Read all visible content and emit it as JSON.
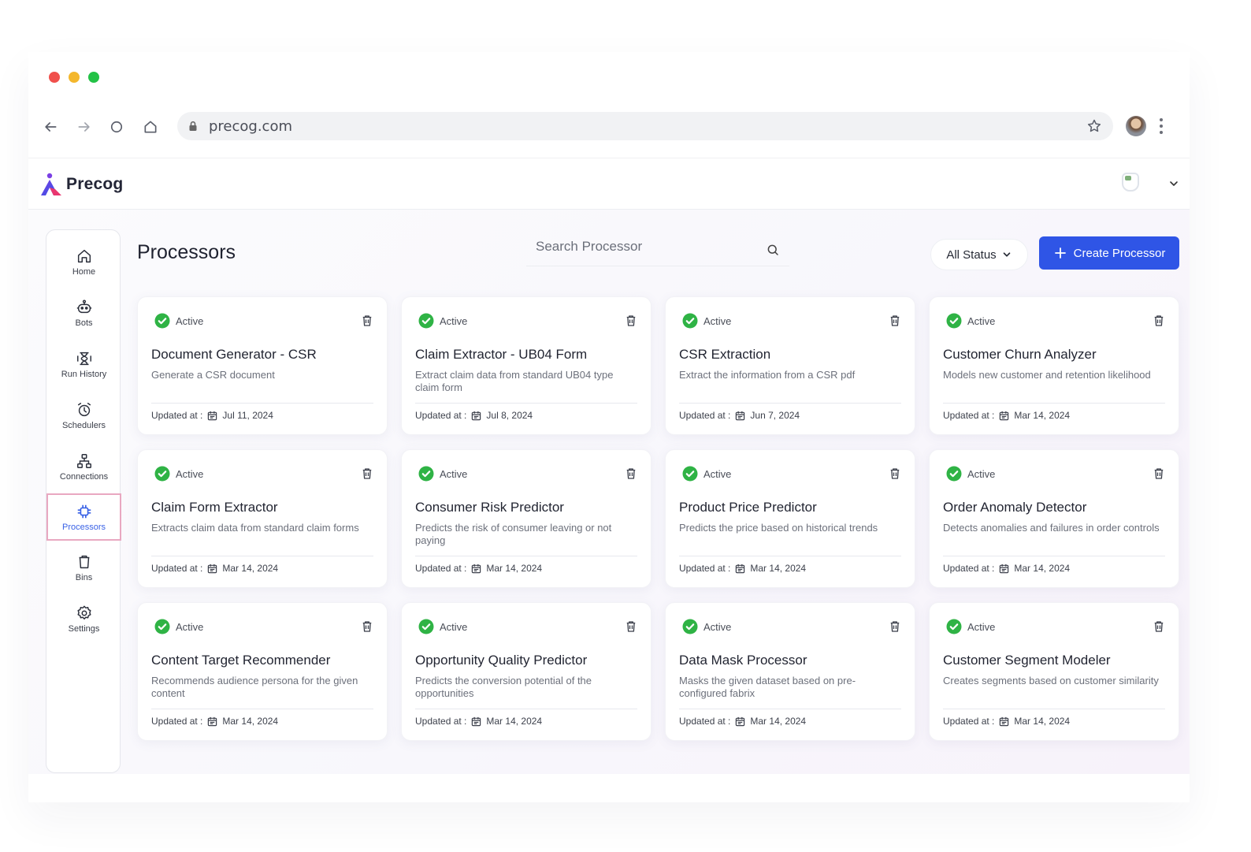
{
  "browser": {
    "url": "precog.com"
  },
  "app": {
    "brand": "Precog"
  },
  "sidebar": {
    "items": [
      {
        "label": "Home",
        "icon": "home-icon"
      },
      {
        "label": "Bots",
        "icon": "bot-icon"
      },
      {
        "label": "Run History",
        "icon": "hourglass-icon"
      },
      {
        "label": "Schedulers",
        "icon": "alarm-clock-icon"
      },
      {
        "label": "Connections",
        "icon": "network-icon"
      },
      {
        "label": "Processors",
        "icon": "chip-icon",
        "active": true
      },
      {
        "label": "Bins",
        "icon": "bin-icon"
      },
      {
        "label": "Settings",
        "icon": "gear-icon"
      }
    ]
  },
  "header": {
    "title": "Processors",
    "search_placeholder": "Search Processor",
    "status_filter": "All Status",
    "create_label": "Create Processor"
  },
  "colors": {
    "accent": "#2f55e6",
    "active_badge": "#2fb345",
    "active_nav_border": "#e9a8c1"
  },
  "cards": [
    {
      "status": "Active",
      "title": "Document Generator - CSR",
      "description": "Generate a CSR document",
      "updated_label": "Updated at :",
      "updated": "Jul 11, 2024"
    },
    {
      "status": "Active",
      "title": "Claim Extractor - UB04 Form",
      "description": "Extract claim data from standard UB04 type claim form",
      "updated_label": "Updated at :",
      "updated": "Jul 8, 2024"
    },
    {
      "status": "Active",
      "title": "CSR Extraction",
      "description": "Extract the information from a CSR pdf",
      "updated_label": "Updated at :",
      "updated": "Jun 7, 2024"
    },
    {
      "status": "Active",
      "title": "Customer Churn Analyzer",
      "description": "Models new customer and retention likelihood",
      "updated_label": "Updated at :",
      "updated": "Mar 14, 2024"
    },
    {
      "status": "Active",
      "title": "Claim Form Extractor",
      "description": "Extracts claim data from standard claim forms",
      "updated_label": "Updated at :",
      "updated": "Mar 14, 2024"
    },
    {
      "status": "Active",
      "title": "Consumer Risk Predictor",
      "description": "Predicts the risk of consumer leaving or not paying",
      "updated_label": "Updated at :",
      "updated": "Mar 14, 2024"
    },
    {
      "status": "Active",
      "title": "Product Price Predictor",
      "description": "Predicts the price based on historical trends",
      "updated_label": "Updated at :",
      "updated": "Mar 14, 2024"
    },
    {
      "status": "Active",
      "title": "Order Anomaly Detector",
      "description": "Detects anomalies and failures in order controls",
      "updated_label": "Updated at :",
      "updated": "Mar 14, 2024"
    },
    {
      "status": "Active",
      "title": "Content Target Recommender",
      "description": "Recommends audience persona for the given content",
      "updated_label": "Updated at :",
      "updated": "Mar 14, 2024"
    },
    {
      "status": "Active",
      "title": "Opportunity Quality Predictor",
      "description": "Predicts the conversion potential of the opportunities",
      "updated_label": "Updated at :",
      "updated": "Mar 14, 2024"
    },
    {
      "status": "Active",
      "title": "Data Mask Processor",
      "description": "Masks the given dataset based on pre-configured fabrix",
      "updated_label": "Updated at :",
      "updated": "Mar 14, 2024"
    },
    {
      "status": "Active",
      "title": "Customer Segment Modeler",
      "description": "Creates segments based on customer similarity",
      "updated_label": "Updated at :",
      "updated": "Mar 14, 2024"
    }
  ]
}
